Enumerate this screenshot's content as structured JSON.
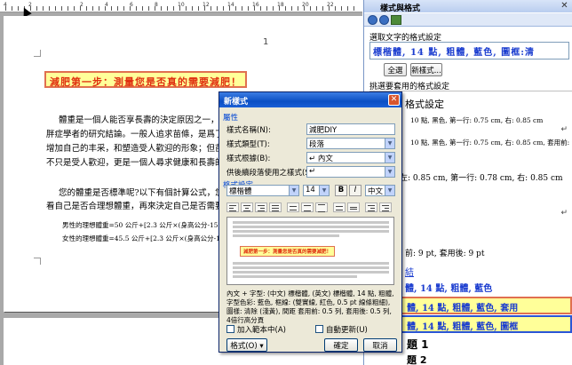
{
  "ruler": {
    "numbers": [
      "4",
      "2",
      "2",
      "4",
      "6",
      "8",
      "10",
      "12",
      "14",
      "16",
      "18",
      "20",
      "22"
    ]
  },
  "document": {
    "page_number": "1",
    "headline": "減肥第一步：測量您是否真的需要減肥！",
    "paragraphs": [
      "體重是一個人能否享長壽的決定原因之一，這是",
      "胖症學者的研究結論。一般人追求苗條，是爲了美",
      "增加自己的丰采，和塑造受人歡迎的形象；但苗條",
      "不只是受人歡迎，更是一個人尋求健康和長壽的必",
      "您的體重是否標準呢?以下有個計算公式，您不",
      "看自己是否合理想體重，再來決定自己是否需要"
    ],
    "formulas": [
      "男性的理想體重=50 公斤+[2.3 公斤×(身高公分-152",
      "女性的理想體重=45.5 公斤+[2.3 公斤×(身高公分-152"
    ]
  },
  "task_pane": {
    "title": "樣式與格式",
    "select_label": "選取文字的格式設定",
    "selected_format": "標楷體, 14 點, 粗體, 藍色, 圖框:清",
    "select_all_button": "全選",
    "new_style_button": "新樣式...",
    "apply_label": "挑選要套用的格式設定",
    "list_items": [
      "格式設定",
      "10 點, 黑色, 第一行: 0.75 cm, 右: 0.85 cm",
      "10 點, 黑色, 第一行: 0.75 cm, 右: 0.85 cm, 套用前: 9",
      "左: 0.85 cm, 第一行: 0.78 cm, 右: 0.85 cm",
      "前: 9 pt, 套用後: 9 pt",
      "結",
      "體, 14 點, 粗體, 藍色",
      "體, 14 點, 粗體, 藍色, 套用",
      "體, 14 點, 粗體, 藍色, 圖框",
      "題 1",
      "題 2"
    ],
    "return_mark": "↵"
  },
  "dialog": {
    "title": "新樣式",
    "properties_group": "屬性",
    "name_label": "樣式名稱(N):",
    "name_value": "減肥DIY",
    "type_label": "樣式類型(T):",
    "type_value": "段落",
    "based_on_label": "樣式根據(B):",
    "based_on_value": "↵ 內文",
    "next_label": "供後續段落使用之樣式(S):",
    "next_value": "↵",
    "format_group": "格式設定",
    "font_value": "標楷體",
    "size_value": "14",
    "bold_label": "B",
    "italic_label": "I",
    "lang_value": "中文",
    "preview_sample": "減肥第一步：測量您是否真的需要減肥！",
    "description": "內文 + 字型: (中文) 標楷體, (英文) 標楷體, 14 點, 粗體, 字型色彩: 藍色, 框線: (雙實線, 紅色, 0.5 pt 線條粗細), 圖樣: 清除 (淺黃), 間距 套用前: 0.5 列, 套用後: 0.5 列, 4倍行高分頁",
    "add_to_template_label": "加入範本中(A)",
    "auto_update_label": "自動更新(U)",
    "format_button": "格式(O) ▾",
    "ok_button": "確定",
    "cancel_button": "取消"
  },
  "colors": {
    "accent_blue": "#1a3ccf",
    "headline_red": "#e03010",
    "highlight_yellow": "#ffff99",
    "border_red": "#e07050"
  }
}
